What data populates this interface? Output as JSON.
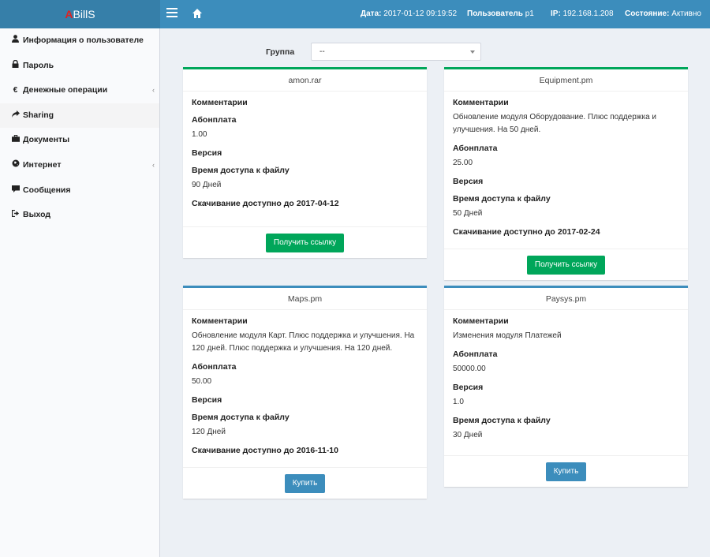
{
  "header": {
    "logo_a": "A",
    "logo_rest": "BillS",
    "date_label": "Дата:",
    "date_value": "2017-01-12 09:19:52",
    "user_label": "Пользователь",
    "user_value": "p1",
    "ip_label": "IP:",
    "ip_value": "192.168.1.208",
    "state_label": "Состояние:",
    "state_value": "Активно",
    "colors": {
      "header_bg": "#3c8dbc",
      "logo_bg": "#367fa9",
      "logo_accent": "#dd2222"
    }
  },
  "sidebar": {
    "items": [
      {
        "icon": "user-icon",
        "label": "Информация о пользователе"
      },
      {
        "icon": "lock-icon",
        "label": "Пароль"
      },
      {
        "icon": "euro-icon",
        "label": "Денежные операции"
      },
      {
        "icon": "share-icon",
        "label": "Sharing"
      },
      {
        "icon": "briefcase-icon",
        "label": "Документы"
      },
      {
        "icon": "globe-icon",
        "label": "Интернет"
      },
      {
        "icon": "comment-icon",
        "label": "Сообщения"
      },
      {
        "icon": "sign-out-icon",
        "label": "Выход"
      }
    ]
  },
  "filter": {
    "group_label": "Группа",
    "group_value": "--"
  },
  "cards": [
    {
      "title": "amon.rar",
      "comments_label": "Комментарии",
      "comments_value": "",
      "fee_label": "Абонплата",
      "fee_value": "1.00",
      "version_label": "Версия",
      "version_value": "",
      "access_label": "Время доступа к файлу",
      "access_value": "90 Дней",
      "download_label": "Скачивание доступно до",
      "download_value": "2017-04-12",
      "button_label": "Получить ссылку"
    },
    {
      "title": "Equipment.pm",
      "comments_label": "Комментарии",
      "comments_value": "Обновление модуля Оборудование. Плюс поддержка и улучшения. На 50 дней.",
      "fee_label": "Абонплата",
      "fee_value": "25.00",
      "version_label": "Версия",
      "version_value": "",
      "access_label": "Время доступа к файлу",
      "access_value": "50 Дней",
      "download_label": "Скачивание доступно до",
      "download_value": "2017-02-24",
      "button_label": "Получить ссылку"
    },
    {
      "title": "Maps.pm",
      "comments_label": "Комментарии",
      "comments_value": "Обновление модуля Карт. Плюс поддержка и улучшения. На 120 дней. Плюс поддержка и улучшения. На 120 дней.",
      "fee_label": "Абонплата",
      "fee_value": "50.00",
      "version_label": "Версия",
      "version_value": "",
      "access_label": "Время доступа к файлу",
      "access_value": "120 Дней",
      "download_label": "Скачивание доступно до",
      "download_value": "2016-11-10",
      "button_label": "Купить"
    },
    {
      "title": "Paysys.pm",
      "comments_label": "Комментарии",
      "comments_value": "Изменения модуля Платежей",
      "fee_label": "Абонплата",
      "fee_value": "50000.00",
      "version_label": "Версия",
      "version_value": "1.0",
      "access_label": "Время доступа к файлу",
      "access_value": "30 Дней",
      "button_label": "Купить"
    }
  ]
}
